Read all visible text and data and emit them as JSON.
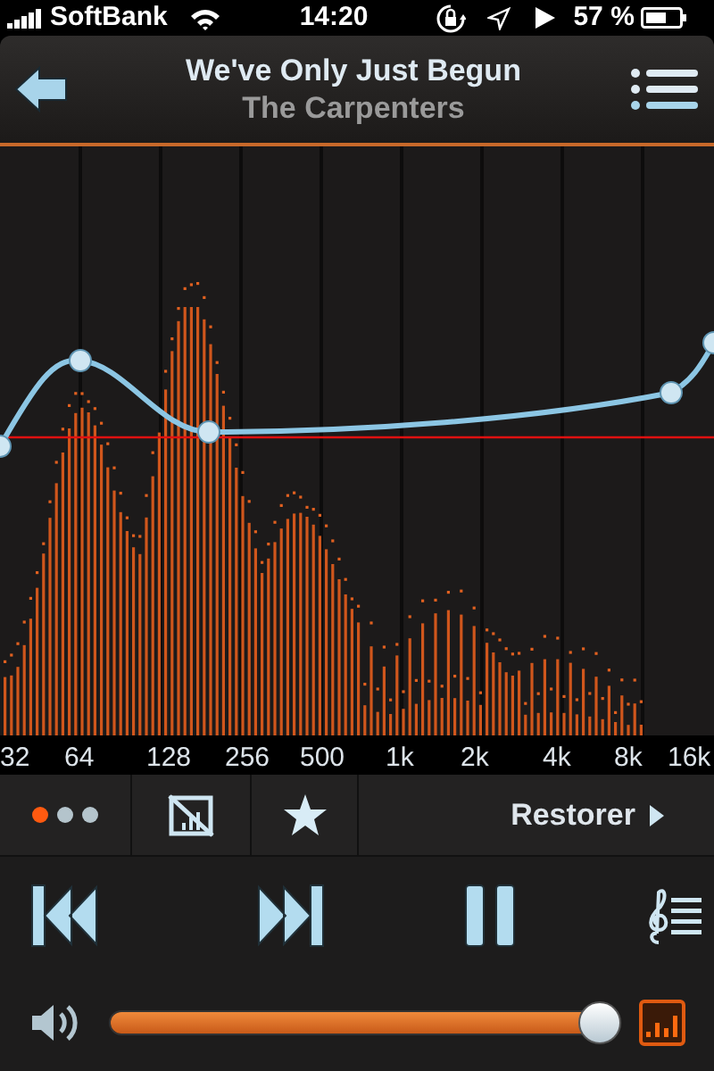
{
  "status_bar": {
    "carrier": "SoftBank",
    "time": "14:20",
    "battery": "57 %"
  },
  "header": {
    "title": "We've Only Just Begun",
    "artist": "The Carpenters"
  },
  "frequency_labels": [
    "32",
    "64",
    "128",
    "256",
    "500",
    "1k",
    "2k",
    "4k",
    "8k",
    "16k"
  ],
  "toolbar": {
    "pages": [
      {
        "selected": true
      },
      {
        "selected": false
      },
      {
        "selected": false
      }
    ],
    "preset": "Restorer"
  },
  "volume": {
    "level": 0.96
  }
}
